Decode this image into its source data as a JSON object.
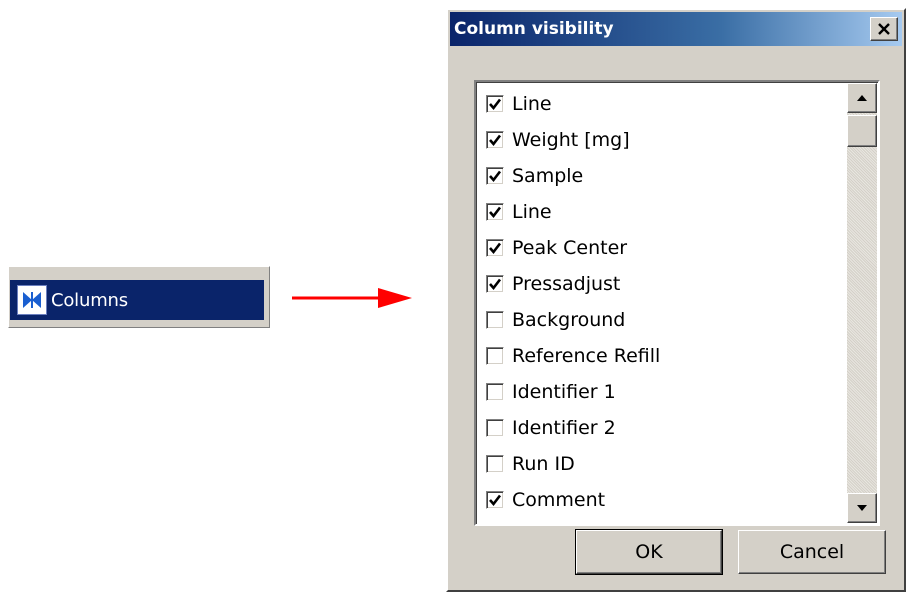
{
  "menu": {
    "label": "Columns",
    "icon": "bowtie-icon",
    "highlight_color": "#0a246a"
  },
  "arrow": {
    "color": "#ff0000"
  },
  "dialog": {
    "title": "Column visibility",
    "close_symbol": "X",
    "items": [
      {
        "label": "Line",
        "checked": true
      },
      {
        "label": "Weight [mg]",
        "checked": true
      },
      {
        "label": "Sample",
        "checked": true
      },
      {
        "label": "Line",
        "checked": true
      },
      {
        "label": "Peak Center",
        "checked": true
      },
      {
        "label": "Pressadjust",
        "checked": true
      },
      {
        "label": "Background",
        "checked": false
      },
      {
        "label": "Reference Refill",
        "checked": false
      },
      {
        "label": "Identifier 1",
        "checked": false
      },
      {
        "label": "Identifier 2",
        "checked": false
      },
      {
        "label": "Run ID",
        "checked": false
      },
      {
        "label": "Comment",
        "checked": true
      }
    ],
    "ok_label": "OK",
    "cancel_label": "Cancel"
  }
}
